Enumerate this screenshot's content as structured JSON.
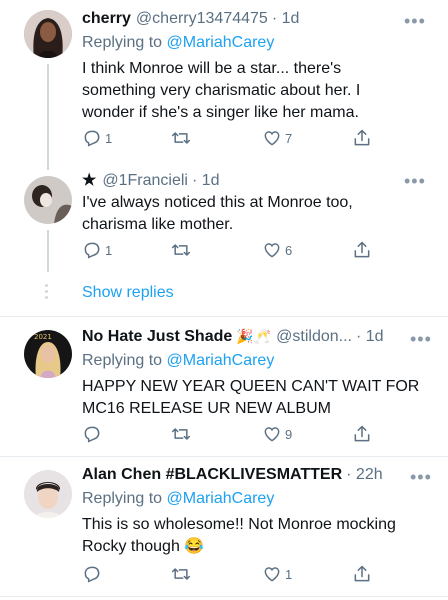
{
  "tweets": [
    {
      "name": "cherry",
      "handle": "@cherry13474475",
      "time": "· 1d",
      "replying_prefix": "Replying to ",
      "replying_to": "@MariahCarey",
      "lines": [
        "I think Monroe will be a star... there's",
        "something very charismatic about her. I",
        "wonder if she's a singer like her mama."
      ],
      "reply_count": "1",
      "retweet_count": "",
      "like_count": "7"
    },
    {
      "star": "★",
      "handle": "@1Francieli",
      "time": "· 1d",
      "lines": [
        "I've always noticed this at Monroe too,",
        "charisma like mother."
      ],
      "reply_count": "1",
      "retweet_count": "",
      "like_count": "6"
    },
    {
      "name": "No Hate Just Shade",
      "name_emoji": "🎉🥂",
      "handle": "@stildon...",
      "time": "· 1d",
      "replying_prefix": "Replying to ",
      "replying_to": "@MariahCarey",
      "lines": [
        "HAPPY NEW YEAR QUEEN CAN'T WAIT FOR",
        "MC16 RELEASE UR NEW ALBUM"
      ],
      "reply_count": "",
      "retweet_count": "",
      "like_count": "9"
    },
    {
      "name": "Alan Chen #BLACKLIVESMATTER",
      "time": "· 22h",
      "replying_prefix": "Replying to ",
      "replying_to": "@MariahCarey",
      "lines": [
        "This is so wholesome!! Not Monroe mocking",
        "Rocky though"
      ],
      "line_emoji": "😂",
      "reply_count": "",
      "retweet_count": "",
      "like_count": "1"
    }
  ],
  "show_replies": "Show replies",
  "more_glyph": "•••",
  "icons": [
    "reply-icon",
    "retweet-icon",
    "like-icon",
    "share-icon",
    "more-icon"
  ],
  "colors": {
    "link": "#1da1f2",
    "secondary": "#5b7083",
    "text": "#0f1419",
    "divider": "#e6ecf0"
  }
}
